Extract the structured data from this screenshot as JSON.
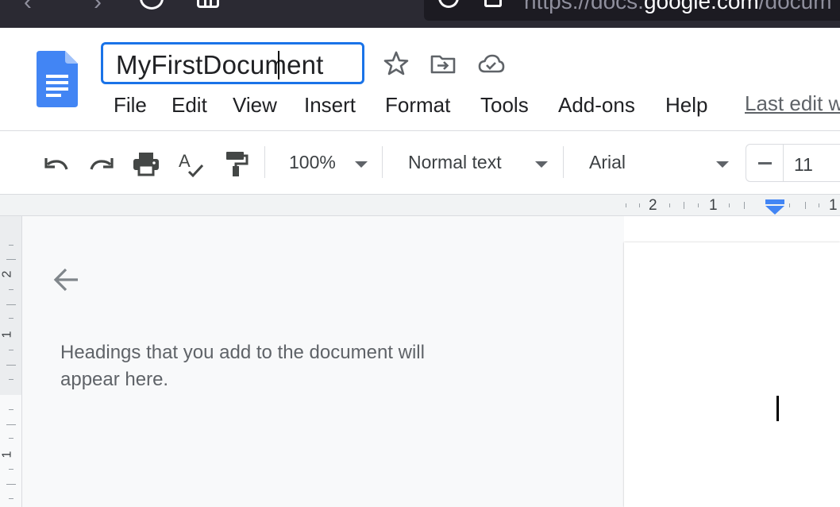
{
  "browser": {
    "url_host_prefix": "https://docs.",
    "url_host_domain": "google.com",
    "url_path": "/docum"
  },
  "document": {
    "title": "MyFirstDocument"
  },
  "menu": {
    "file": "File",
    "edit": "Edit",
    "view": "View",
    "insert": "Insert",
    "format": "Format",
    "tools": "Tools",
    "addons": "Add-ons",
    "help": "Help",
    "last_edit": "Last edit w"
  },
  "toolbar": {
    "zoom": "100%",
    "style": "Normal text",
    "font": "Arial",
    "font_size": "11"
  },
  "ruler": {
    "top_numbers": [
      "2",
      "1",
      "1"
    ],
    "left_numbers": [
      "2",
      "1",
      "1"
    ]
  },
  "outline": {
    "hint": "Headings that you add to the document will appear here."
  },
  "colors": {
    "accent": "#1a73e8",
    "docs_blue": "#4285f4",
    "browser_dark": "#2b2a33",
    "panel_bg": "#f8f9fa"
  },
  "icons": {
    "back": "arrow-left-icon",
    "star": "star-icon",
    "move": "move-to-folder-icon",
    "cloud": "cloud-saved-icon",
    "undo": "undo-icon",
    "redo": "redo-icon",
    "print": "print-icon",
    "spellcheck": "spellcheck-icon",
    "paint_format": "paint-format-icon"
  }
}
